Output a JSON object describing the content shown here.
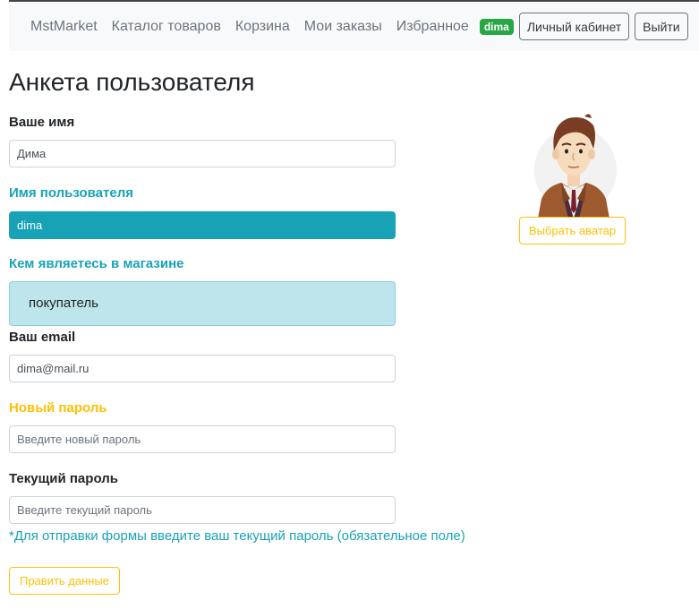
{
  "navbar": {
    "brand": "MstMarket",
    "links": [
      "Каталог товаров",
      "Корзина",
      "Мои заказы",
      "Избранное"
    ],
    "user_badge": "dima",
    "cabinet_button": "Личный кабинет",
    "logout_button": "Выйти"
  },
  "page": {
    "title": "Анкета пользователя"
  },
  "form": {
    "name_label": "Ваше имя",
    "name_value": "Дима",
    "username_label": "Имя пользователя",
    "username_value": "dima",
    "role_label": "Кем являетесь в магазине",
    "role_value": "покупатель",
    "email_label": "Ваш email",
    "email_value": "dima@mail.ru",
    "new_password_label": "Новый пароль",
    "new_password_placeholder": "Введите новый пароль",
    "current_password_label": "Текущий пароль",
    "current_password_placeholder": "Введите текущий пароль",
    "hint": "*Для отправки формы введите ваш текущий пароль (обязательное поле)",
    "submit_button": "Править данные"
  },
  "avatar": {
    "icon": "user-avatar-icon",
    "choose_button": "Выбрать аватар"
  },
  "colors": {
    "info": "#17a2b8",
    "warning": "#ffc107",
    "success": "#28a745"
  }
}
